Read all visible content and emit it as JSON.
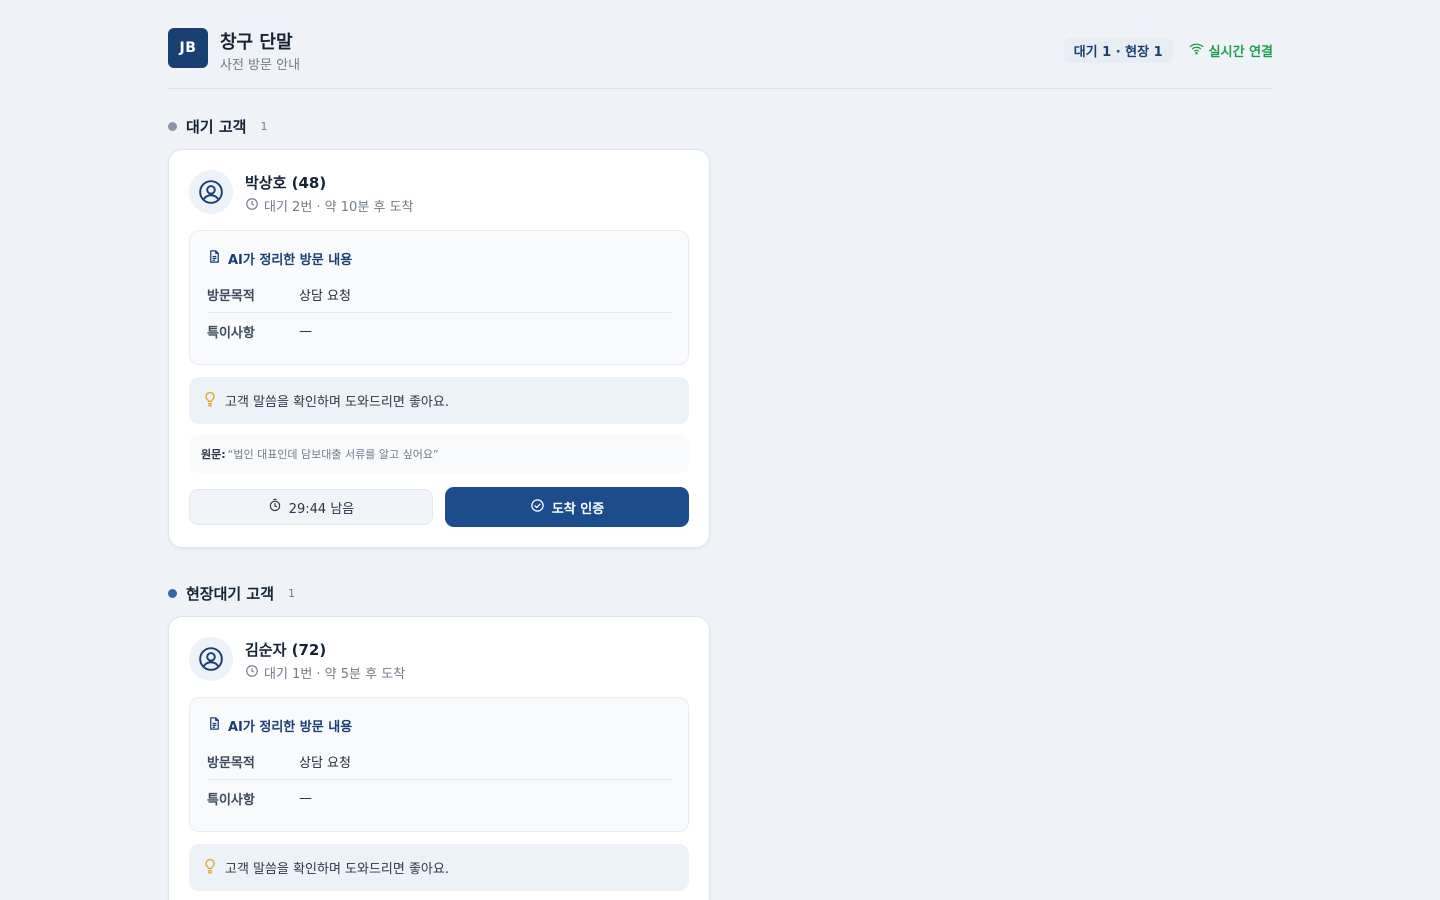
{
  "header": {
    "logo": "JB",
    "title": "창구 단말",
    "subtitle": "사전 방문 안내",
    "counts": "대기 1 · 현장 1",
    "live_status": "실시간 연결",
    "live_color": "#1f9d4f"
  },
  "sections": [
    {
      "title": "대기 고객",
      "count": "1",
      "dot_color": "#8a96a8",
      "card": {
        "name": "박상호 (48)",
        "meta": "대기 2번 · 약 10분 후 도착",
        "ai_title": "AI가 정리한 방문 내용",
        "purpose_label": "방문목적",
        "purpose_value": "상담 요청",
        "note_label": "특이사항",
        "note_value": "—",
        "tip": "고객 말씀을 확인하며 도와드리면 좋아요.",
        "original_label": "원문:",
        "original_text": "“법인 대표인데 담보대출 서류를 알고 싶어요”",
        "timer": "29:44 남음",
        "arrive": "도착 인증"
      }
    },
    {
      "title": "현장대기 고객",
      "count": "1",
      "dot_color": "#2f66ad",
      "card": {
        "name": "김순자 (72)",
        "meta": "대기 1번 · 약 5분 후 도착",
        "ai_title": "AI가 정리한 방문 내용",
        "purpose_label": "방문목적",
        "purpose_value": "상담 요청",
        "note_label": "특이사항",
        "note_value": "—",
        "tip": "고객 말씀을 확인하며 도와드리면 좋아요."
      }
    }
  ],
  "icons": {
    "avatar": "user-circle-icon",
    "clock": "clock-icon",
    "document": "document-icon",
    "bulb": "lightbulb-icon",
    "timer": "stopwatch-icon",
    "check": "check-circle-icon",
    "wifi": "wifi-icon"
  },
  "colors": {
    "brand": "#1a3f73",
    "primary_button": "#1c4c8c",
    "tip_icon": "#e0a020",
    "background": "#eff3f8"
  }
}
